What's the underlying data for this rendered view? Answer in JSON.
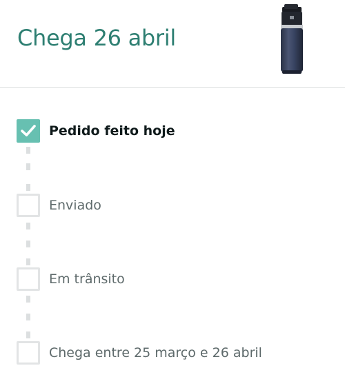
{
  "header": {
    "title": "Chega 26 abril",
    "product_icon": "tumbler-bottle-image"
  },
  "colors": {
    "title": "#2e7f72",
    "check": "#67c0b1",
    "inactive_text": "#5e6a6b",
    "active_text": "#0f1a1b"
  },
  "timeline": {
    "steps": [
      {
        "label": "Pedido feito hoje",
        "completed": true
      },
      {
        "label": "Enviado",
        "completed": false
      },
      {
        "label": "Em trânsito",
        "completed": false
      },
      {
        "label": "Chega entre 25 março e 26 abril",
        "completed": false
      }
    ]
  }
}
